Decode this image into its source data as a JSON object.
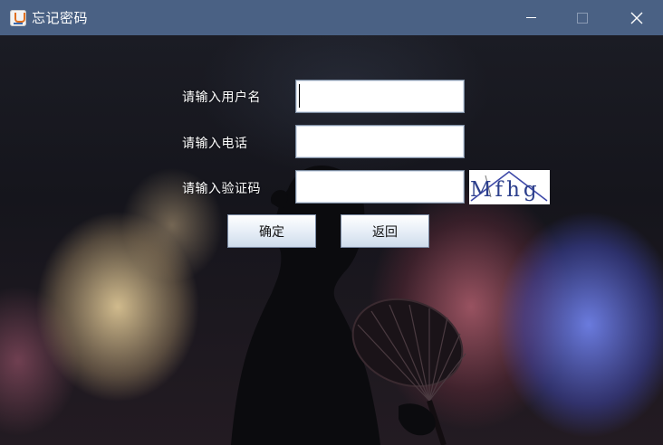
{
  "window": {
    "title": "忘记密码",
    "controls": {
      "minimize": "minimize-icon",
      "maximize": "maximize-icon",
      "close": "close-icon"
    },
    "titlebar_color": "#4a6184"
  },
  "form": {
    "username_label": "请输入用户名",
    "username_value": "",
    "phone_label": "请输入电话",
    "phone_value": "",
    "captcha_label": "请输入验证码",
    "captcha_value": "",
    "captcha_image_text": "Mfhg"
  },
  "buttons": {
    "confirm_label": "确定",
    "back_label": "返回"
  }
}
